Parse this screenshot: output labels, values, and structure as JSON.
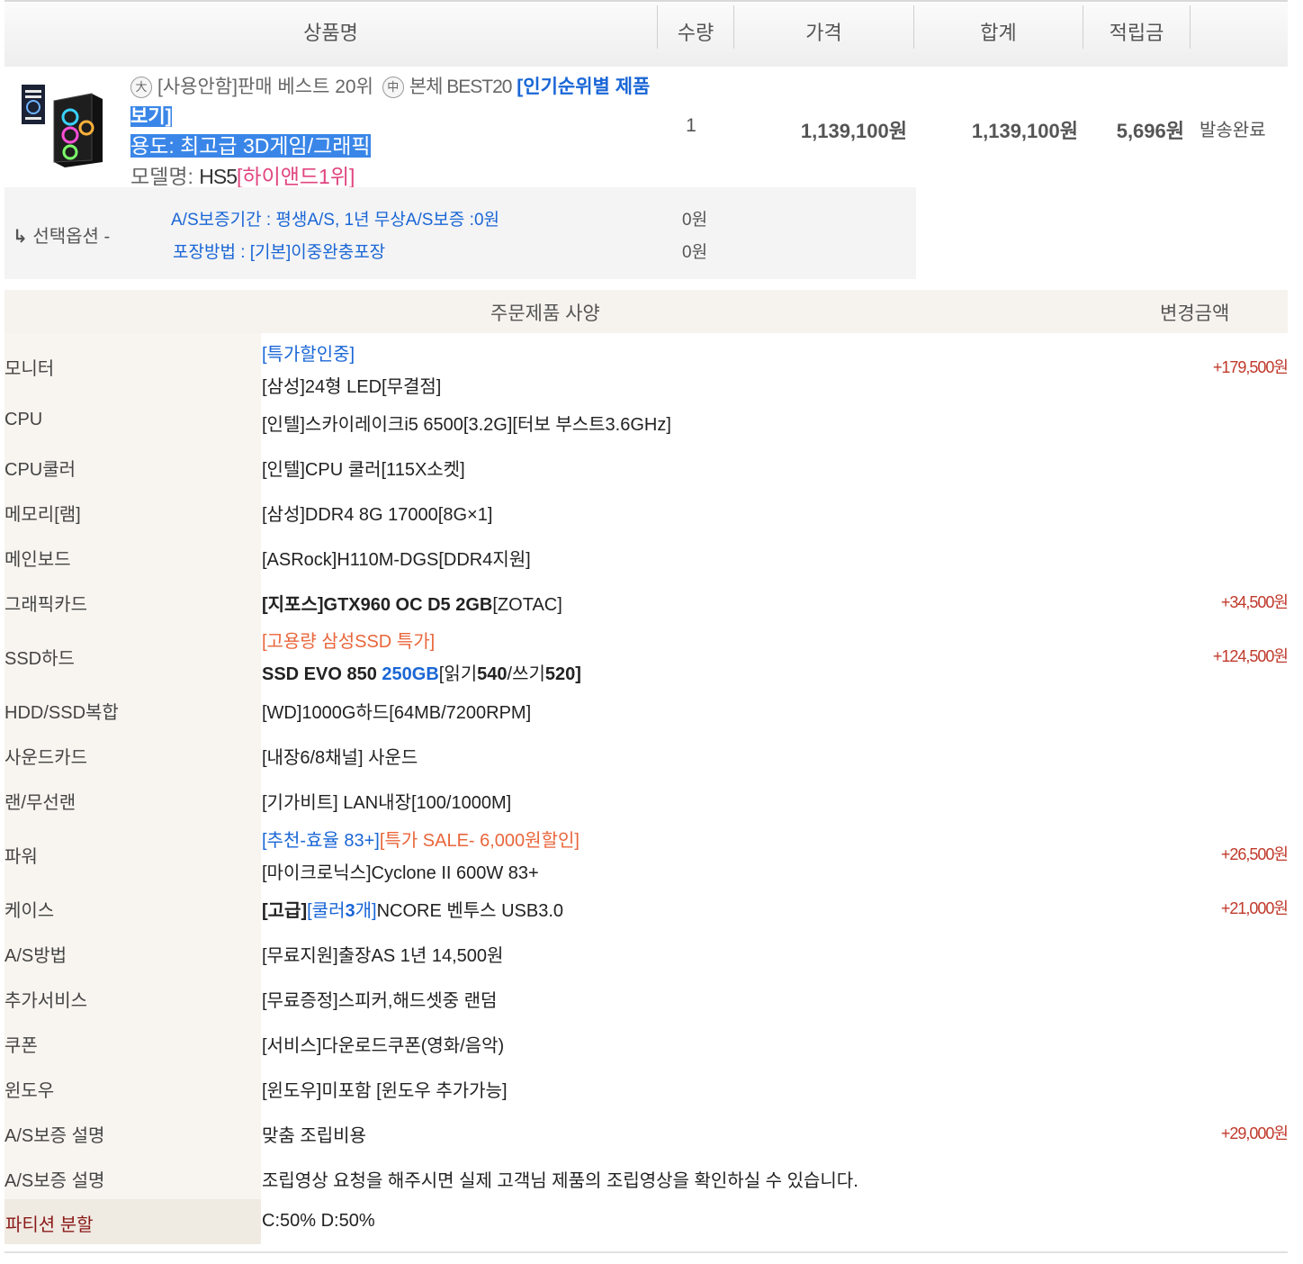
{
  "header": {
    "product": "상품명",
    "qty": "수량",
    "price": "가격",
    "total": "합계",
    "points": "적립금"
  },
  "product": {
    "icon_big": "大",
    "tag1": "[사용안함]판매 베스트 20위",
    "icon_mid": "中",
    "tag2": "본체 BEST20",
    "link_text_1": "[인기순위별 제품",
    "link_text_2": "보기]",
    "usage": "용도: 최고급 3D게임/그래픽",
    "model_label": "모델명: ",
    "model": "HS5",
    "rank": "[하이앤드1위]",
    "qty": "1",
    "price": "1,139,100원",
    "total": "1,139,100원",
    "points": "5,696원",
    "status": "발송완료"
  },
  "options": {
    "label": "선택옵션 -",
    "items": [
      {
        "text": "A/S보증기간 : 평생A/S, 1년 무상A/S보증 :0원",
        "price": "0원"
      },
      {
        "text": "포장방법 : [기본]이중완충포장",
        "price": "0원"
      }
    ]
  },
  "spec_header": {
    "title": "주문제품 사양",
    "change": "변경금액"
  },
  "specs": [
    {
      "label": "모니터",
      "line1": "[특가할인중]",
      "line2": "[삼성]24형 LED[무결점]",
      "amount": "+179,500원"
    },
    {
      "label": "CPU",
      "value": "[인텔]스카이레이크i5 6500[3.2G][터보 부스트3.6GHz]"
    },
    {
      "label": "CPU쿨러",
      "value": "[인텔]CPU 쿨러[115X소켓]"
    },
    {
      "label": "메모리[램]",
      "value": "[삼성]DDR4 8G 17000[8G×1]"
    },
    {
      "label": "메인보드",
      "value": "[ASRock]H110M-DGS[DDR4지원]"
    },
    {
      "label": "그래픽카드",
      "v_bold": "[지포스]GTX960 OC D5 2GB",
      "v_rest": "[ZOTAC]",
      "amount": "+34,500원"
    },
    {
      "label": "SSD하드",
      "line1": "[고용량 삼성SSD 특가]",
      "s1": "SSD EVO 850 ",
      "s2": "250GB",
      "s3": "[읽기",
      "s4": "540",
      "s5": "/쓰기",
      "s6": "520]",
      "amount": "+124,500원"
    },
    {
      "label": "HDD/SSD복합",
      "value": "[WD]1000G하드[64MB/7200RPM]"
    },
    {
      "label": "사운드카드",
      "value": "[내장6/8채널] 사운드"
    },
    {
      "label": "랜/무선랜",
      "value": "[기가비트] LAN내장[100/1000M]"
    },
    {
      "label": "파워",
      "l1a": "[추천-효율 83+]",
      "l1b": "[특가 SALE- 6,000원할인]",
      "line2": "[마이크로닉스]Cyclone II 600W 83+",
      "amount": "+26,500원"
    },
    {
      "label": "케이스",
      "c1": "[고급]",
      "c2": "[쿨러",
      "c3": "3",
      "c4": "개]",
      "c5": "NCORE 벤투스 USB3.0",
      "amount": "+21,000원"
    },
    {
      "label": "A/S방법",
      "value": "[무료지원]출장AS 1년 14,500원"
    },
    {
      "label": "추가서비스",
      "value": "[무료증정]스피커,해드셋중 랜덤"
    },
    {
      "label": "쿠폰",
      "value": "[서비스]다운로드쿠폰(영화/음악)"
    },
    {
      "label": "윈도우",
      "value": "[윈도우]미포함 [윈도우 추가가능]"
    },
    {
      "label": "A/S보증 설명",
      "value": "맞춤 조립비용",
      "amount": "+29,000원"
    },
    {
      "label": "A/S보증 설명",
      "value": "조립영상 요청을 해주시면 실제 고객님 제품의 조립영상을 확인하실 수 있습니다."
    },
    {
      "label": "파티션 분할",
      "value": "C:50% D:50%"
    }
  ]
}
